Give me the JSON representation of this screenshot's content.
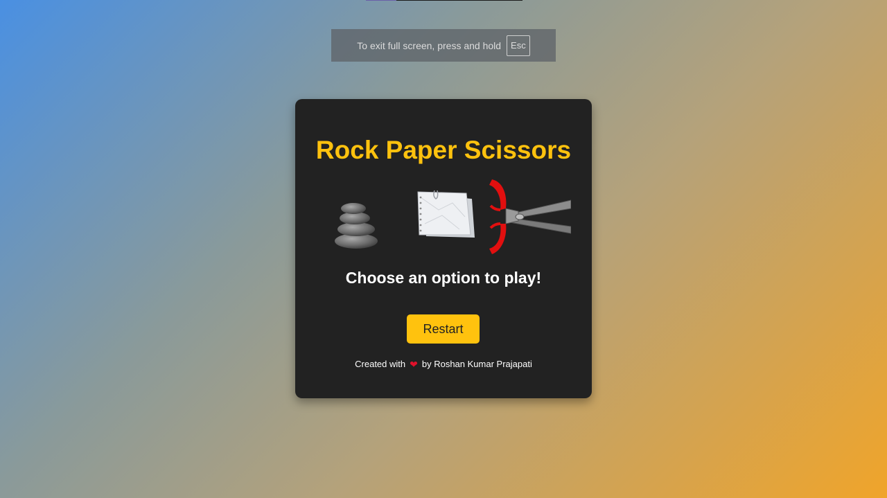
{
  "fullscreen_notice": {
    "text": "To exit full screen, press and hold",
    "key": "Esc"
  },
  "game": {
    "title": "Rock Paper Scissors",
    "choices": [
      {
        "label": "rock",
        "icon": "rock-icon"
      },
      {
        "label": "paper",
        "icon": "paper-icon"
      },
      {
        "label": "scissors",
        "icon": "scissors-icon"
      }
    ],
    "prompt": "Choose an option to play!",
    "restart_label": "Restart"
  },
  "footer": {
    "prefix": "Created with",
    "heart_icon": "heart-icon",
    "suffix": "by Roshan Kumar Prajapati"
  },
  "colors": {
    "accent": "#ffc20e",
    "card_bg": "#222222",
    "heart": "#e0112b"
  }
}
